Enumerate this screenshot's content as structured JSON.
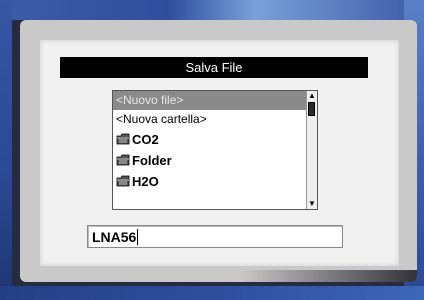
{
  "dialog": {
    "title": "Salva File"
  },
  "file_list": {
    "items": [
      {
        "label": "<Nuovo file>",
        "type": "option",
        "selected": true
      },
      {
        "label": "<Nuova cartella>",
        "type": "option",
        "selected": false
      },
      {
        "label": "CO2",
        "type": "folder",
        "icon": "folder-icon"
      },
      {
        "label": "Folder",
        "type": "folder",
        "icon": "folder-icon"
      },
      {
        "label": "H2O",
        "type": "folder",
        "icon": "folder-icon"
      }
    ],
    "scroll_up": "▲",
    "scroll_down": "▼"
  },
  "filename_input": {
    "value": "LNA56"
  },
  "colors": {
    "frame": "#3557a6",
    "screen": "#f1f1f1",
    "selection": "#8a8a8a",
    "title_bar": "#000000"
  }
}
